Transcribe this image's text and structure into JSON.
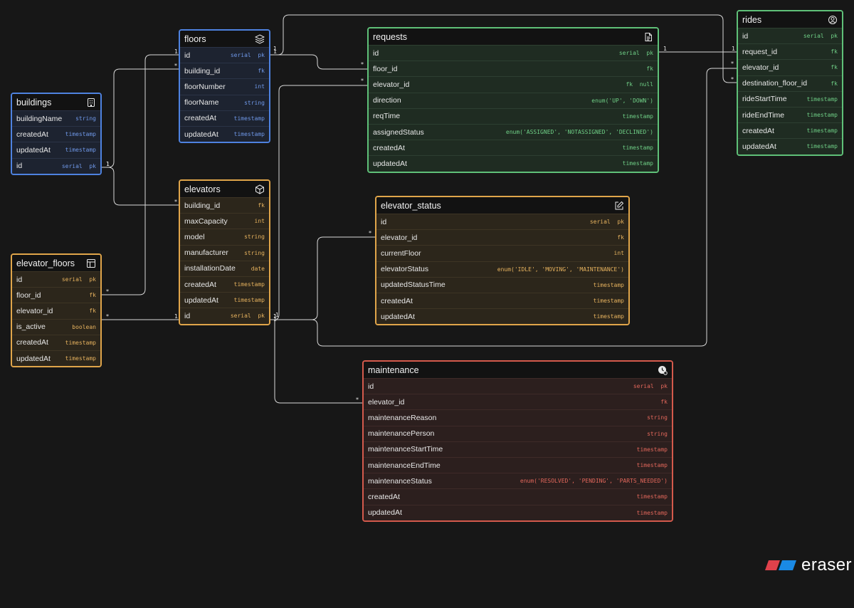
{
  "colors": {
    "blue": "#4e82e0",
    "green": "#5fc078",
    "orange": "#e0a54a",
    "red": "#d45a4c",
    "background": "#171717",
    "connector": "#d9d9d9",
    "logo_red": "#e0414b",
    "logo_blue": "#1a8ae5"
  },
  "tables": {
    "floors": {
      "title": "floors",
      "icon": "layers-icon",
      "fields": [
        {
          "name": "id",
          "type": "serial  pk"
        },
        {
          "name": "building_id",
          "type": "fk"
        },
        {
          "name": "floorNumber",
          "type": "int"
        },
        {
          "name": "floorName",
          "type": "string"
        },
        {
          "name": "createdAt",
          "type": "timestamp"
        },
        {
          "name": "updatedAt",
          "type": "timestamp"
        }
      ]
    },
    "buildings": {
      "title": "buildings",
      "icon": "building-icon",
      "fields": [
        {
          "name": "buildingName",
          "type": "string"
        },
        {
          "name": "createdAt",
          "type": "timestamp"
        },
        {
          "name": "updatedAt",
          "type": "timestamp"
        },
        {
          "name": "id",
          "type": "serial  pk"
        }
      ]
    },
    "elevators": {
      "title": "elevators",
      "icon": "cube-icon",
      "fields": [
        {
          "name": "building_id",
          "type": "fk"
        },
        {
          "name": "maxCapacity",
          "type": "int"
        },
        {
          "name": "model",
          "type": "string"
        },
        {
          "name": "manufacturer",
          "type": "string"
        },
        {
          "name": "installationDate",
          "type": "date"
        },
        {
          "name": "createdAt",
          "type": "timestamp"
        },
        {
          "name": "updatedAt",
          "type": "timestamp"
        },
        {
          "name": "id",
          "type": "serial  pk"
        }
      ]
    },
    "elevator_floors": {
      "title": "elevator_floors",
      "icon": "table-icon",
      "fields": [
        {
          "name": "id",
          "type": "serial  pk"
        },
        {
          "name": "floor_id",
          "type": "fk"
        },
        {
          "name": "elevator_id",
          "type": "fk"
        },
        {
          "name": "is_active",
          "type": "boolean"
        },
        {
          "name": "createdAt",
          "type": "timestamp"
        },
        {
          "name": "updatedAt",
          "type": "timestamp"
        }
      ]
    },
    "requests": {
      "title": "requests",
      "icon": "document-icon",
      "fields": [
        {
          "name": "id",
          "type": "serial  pk"
        },
        {
          "name": "floor_id",
          "type": "fk"
        },
        {
          "name": "elevator_id",
          "type": "fk  null"
        },
        {
          "name": "direction",
          "type": "enum('UP', 'DOWN')"
        },
        {
          "name": "reqTime",
          "type": "timestamp"
        },
        {
          "name": "assignedStatus",
          "type": "enum('ASSIGNED', 'NOTASSIGNED', 'DECLINED')"
        },
        {
          "name": "createdAt",
          "type": "timestamp"
        },
        {
          "name": "updatedAt",
          "type": "timestamp"
        }
      ]
    },
    "elevator_status": {
      "title": "elevator_status",
      "icon": "edit-icon",
      "fields": [
        {
          "name": "id",
          "type": "serial  pk"
        },
        {
          "name": "elevator_id",
          "type": "fk"
        },
        {
          "name": "currentFloor",
          "type": "int"
        },
        {
          "name": "elevatorStatus",
          "type": "enum('IDLE', 'MOVING', 'MAINTENANCE')"
        },
        {
          "name": "updatedStatusTime",
          "type": "timestamp"
        },
        {
          "name": "createdAt",
          "type": "timestamp"
        },
        {
          "name": "updatedAt",
          "type": "timestamp"
        }
      ]
    },
    "rides": {
      "title": "rides",
      "icon": "person-icon",
      "fields": [
        {
          "name": "id",
          "type": "serial  pk"
        },
        {
          "name": "request_id",
          "type": "fk"
        },
        {
          "name": "elevator_id",
          "type": "fk"
        },
        {
          "name": "destination_floor_id",
          "type": "fk"
        },
        {
          "name": "rideStartTime",
          "type": "timestamp"
        },
        {
          "name": "rideEndTime",
          "type": "timestamp"
        },
        {
          "name": "createdAt",
          "type": "timestamp"
        },
        {
          "name": "updatedAt",
          "type": "timestamp"
        }
      ]
    },
    "maintenance": {
      "title": "maintenance",
      "icon": "maintenance-clock-icon",
      "fields": [
        {
          "name": "id",
          "type": "serial  pk"
        },
        {
          "name": "elevator_id",
          "type": "fk"
        },
        {
          "name": "maintenanceReason",
          "type": "string"
        },
        {
          "name": "maintenancePerson",
          "type": "string"
        },
        {
          "name": "maintenanceStartTime",
          "type": "timestamp"
        },
        {
          "name": "maintenanceEndTime",
          "type": "timestamp"
        },
        {
          "name": "maintenanceStatus",
          "type": "enum('RESOLVED', 'PENDING', 'PARTS_NEEDED')"
        },
        {
          "name": "createdAt",
          "type": "timestamp"
        },
        {
          "name": "updatedAt",
          "type": "timestamp"
        }
      ]
    }
  },
  "relationships": [
    {
      "from": "floors.id",
      "to": "elevator_floors.floor_id",
      "from_card": "1",
      "to_card": "*"
    },
    {
      "from": "buildings.id",
      "to": "floors.building_id",
      "from_card": "1",
      "to_card": "*"
    },
    {
      "from": "buildings.id",
      "to": "elevators.building_id",
      "from_card": "1",
      "to_card": "*"
    },
    {
      "from": "elevators.id",
      "to": "elevator_floors.elevator_id",
      "from_card": "1",
      "to_card": "*"
    },
    {
      "from": "floors.id",
      "to": "requests.floor_id",
      "from_card": "1",
      "to_card": "*"
    },
    {
      "from": "floors.id",
      "to": "rides.destination_floor_id",
      "from_card": "1",
      "to_card": "*"
    },
    {
      "from": "requests.id",
      "to": "rides.request_id",
      "from_card": "1",
      "to_card": "1"
    },
    {
      "from": "elevators.id",
      "to": "requests.elevator_id",
      "from_card": "1",
      "to_card": "*"
    },
    {
      "from": "elevators.id",
      "to": "elevator_status.elevator_id",
      "from_card": "1",
      "to_card": "*"
    },
    {
      "from": "elevators.id",
      "to": "rides.elevator_id",
      "from_card": "1",
      "to_card": "*"
    },
    {
      "from": "elevators.id",
      "to": "maintenance.elevator_id",
      "from_card": "1",
      "to_card": "*"
    }
  ],
  "logo": {
    "text": "eraser"
  }
}
